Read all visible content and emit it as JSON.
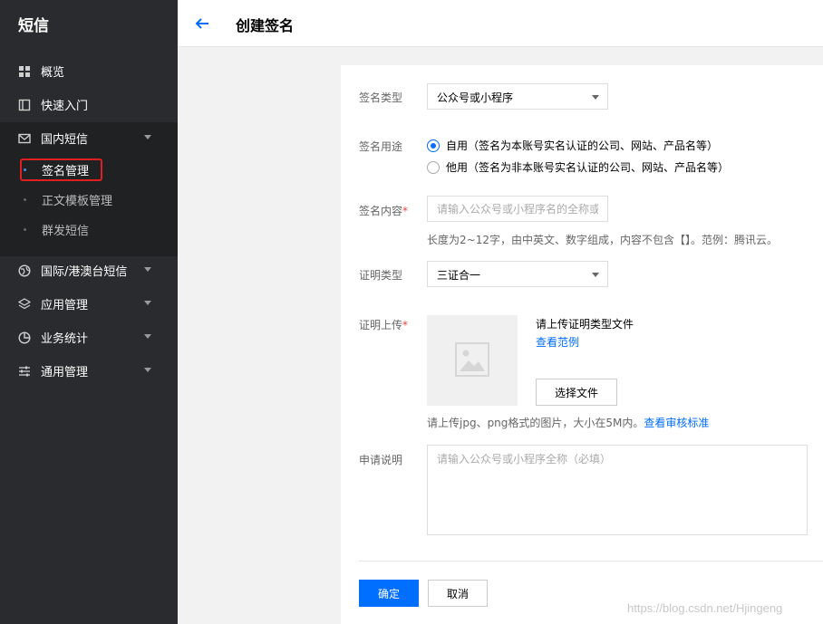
{
  "sidebar": {
    "title": "短信",
    "items": [
      {
        "label": "概览",
        "icon": "grid-icon"
      },
      {
        "label": "快速入门",
        "icon": "book-icon"
      },
      {
        "label": "国内短信",
        "icon": "mail-icon"
      },
      {
        "label": "国际/港澳台短信",
        "icon": "globe-icon"
      },
      {
        "label": "应用管理",
        "icon": "layers-icon"
      },
      {
        "label": "业务统计",
        "icon": "pie-chart-icon"
      },
      {
        "label": "通用管理",
        "icon": "sliders-icon"
      }
    ],
    "sub_items": [
      {
        "label": "签名管理",
        "active": true
      },
      {
        "label": "正文模板管理",
        "active": false
      },
      {
        "label": "群发短信",
        "active": false
      }
    ]
  },
  "header": {
    "title": "创建签名"
  },
  "form": {
    "sign_type": {
      "label": "签名类型",
      "value": "公众号或小程序"
    },
    "sign_use": {
      "label": "签名用途",
      "options": [
        {
          "label": "自用（签名为本账号实名认证的公司、网站、产品名等）",
          "checked": true
        },
        {
          "label": "他用（签名为非本账号实名认证的公司、网站、产品名等）",
          "checked": false
        }
      ]
    },
    "sign_content": {
      "label": "签名内容",
      "required_mark": "*",
      "placeholder": "请输入公众号或小程序名的全称或",
      "hint": "长度为2~12字，由中英文、数字组成，内容不包含【】。范例：腾讯云。"
    },
    "cert_type": {
      "label": "证明类型",
      "value": "三证合一"
    },
    "cert_upload": {
      "label": "证明上传",
      "required_mark": "*",
      "title": "请上传证明类型文件",
      "example_link": "查看范例",
      "choose_file": "选择文件",
      "hint": "请上传jpg、png格式的图片，大小在5M内。",
      "hint_link": "查看审核标准"
    },
    "apply_note": {
      "label": "申请说明",
      "placeholder": "请输入公众号或小程序全称（必填）"
    },
    "confirm_label": "确定",
    "cancel_label": "取消"
  },
  "watermark": "https://blog.csdn.net/Hjingeng",
  "colors": {
    "primary": "#006eff",
    "sidebar_bg": "#2a2b2e",
    "required": "#e54545",
    "highlight_box": "#e02020"
  }
}
